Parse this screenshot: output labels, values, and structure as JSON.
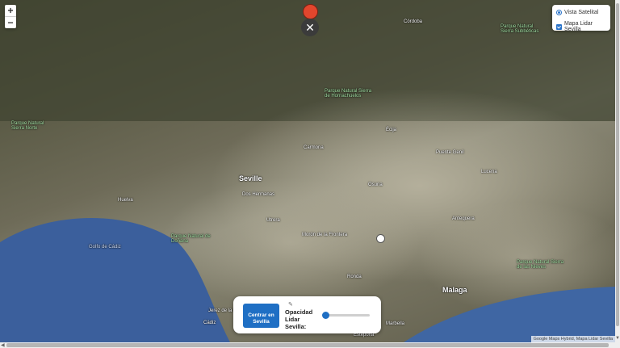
{
  "map": {
    "city_labels": [
      {
        "text": "Seville",
        "big": true
      },
      {
        "text": "Malaga",
        "big": true
      },
      {
        "text": "Córdoba"
      },
      {
        "text": "Jerez de la Frontera"
      },
      {
        "text": "Cádiz"
      },
      {
        "text": "Marbella"
      },
      {
        "text": "Huelva"
      },
      {
        "text": "Ronda"
      },
      {
        "text": "Antequera"
      },
      {
        "text": "Écija"
      },
      {
        "text": "Osuna"
      },
      {
        "text": "Carmona"
      },
      {
        "text": "Lucena"
      },
      {
        "text": "Estepona"
      },
      {
        "text": "Dos Hermanas"
      },
      {
        "text": "Utrera"
      },
      {
        "text": "Puente Genil"
      },
      {
        "text": "Morón de la Frontera"
      },
      {
        "text": "Golfo de Cádiz"
      }
    ],
    "park_labels": [
      {
        "text": "Parque Natural Sierra de Hornachuelos"
      },
      {
        "text": "Parque Natural Sierra de las Nieves"
      },
      {
        "text": "Parque Natural de Doñana"
      },
      {
        "text": "Parque Natural Sierra Norte"
      },
      {
        "text": "Parque Natural Sierra Subbéticas"
      }
    ]
  },
  "zoom": {
    "in_label": "+",
    "out_label": "−"
  },
  "layers": {
    "option1": "Vista Satelital",
    "option2": "Mapa Lidar Sevilla"
  },
  "marker": {
    "color": "#e2462d"
  },
  "close_button": {
    "label": "✕"
  },
  "control_panel": {
    "center_button_label": "Centrar en Sevilla",
    "opacity_label": "Opacidad Lidar Sevilla:",
    "opacity_value": 0.05
  },
  "attribution": "Google Maps Hybrid, Mapa Lidar Sevilla",
  "colors": {
    "accent": "#1f6fc4",
    "sea": "#3b5f9c"
  }
}
